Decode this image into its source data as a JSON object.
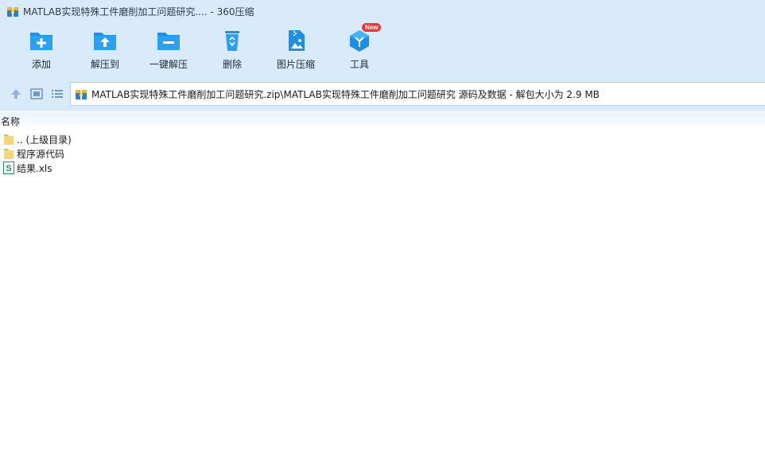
{
  "window": {
    "title": "MATLAB实现特殊工件磨削加工问题研究.... - 360压缩"
  },
  "toolbar": {
    "items": [
      {
        "label": "添加",
        "icon": "add-folder-icon"
      },
      {
        "label": "解压到",
        "icon": "extract-to-icon"
      },
      {
        "label": "一键解压",
        "icon": "one-click-extract-icon"
      },
      {
        "label": "删除",
        "icon": "recycle-bin-icon"
      },
      {
        "label": "图片压缩",
        "icon": "image-compress-icon"
      },
      {
        "label": "工具",
        "icon": "tools-cube-icon",
        "badge": "New"
      }
    ]
  },
  "address": {
    "path": "MATLAB实现特殊工件磨削加工问题研究.zip\\MATLAB实现特殊工件磨削加工问题研究 源码及数据 - 解包大小为 2.9 MB"
  },
  "list": {
    "column_name": "名称",
    "items": [
      {
        "name": ".. (上级目录)",
        "icon": "folder-icon"
      },
      {
        "name": "程序源代码",
        "icon": "folder-icon"
      },
      {
        "name": "结果.xls",
        "icon": "spreadsheet-icon"
      }
    ]
  },
  "colors": {
    "toolbar_bg": "#d9eafb",
    "icon_blue": "#1e8fe6",
    "badge_red": "#e8383d",
    "folder_yellow": "#f5d57a",
    "sheet_green": "#1f8f5f"
  }
}
